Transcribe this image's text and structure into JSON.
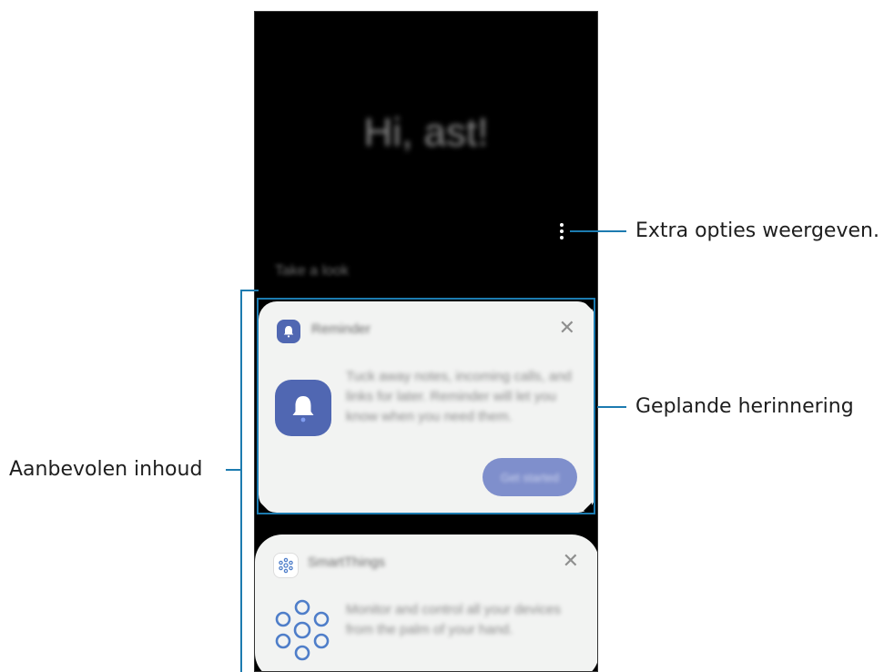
{
  "callouts": {
    "extra_options": "Extra opties weergeven.",
    "scheduled_reminder": "Geplande herinnering",
    "recommended_content": "Aanbevolen inhoud"
  },
  "screen": {
    "greeting": "Hi, ast!",
    "take_a_look": "Take a look"
  },
  "reminder_card": {
    "app_name": "Reminder",
    "close_glyph": "✕",
    "body": "Tuck away notes, incoming calls, and links for later. Reminder will let you know when you need them.",
    "action_label": "Get started",
    "icon": "bell-icon",
    "accent": "#5067b2"
  },
  "smartthings_card": {
    "app_name": "SmartThings",
    "close_glyph": "✕",
    "body": "Monitor and control all your devices from the palm of your hand.",
    "icon": "smartthings-icon",
    "accent": "#4f7ec9"
  },
  "colors": {
    "callout_line": "#1c7bb0",
    "screen_bg": "#000000",
    "card_bg": "#f2f3f2"
  }
}
